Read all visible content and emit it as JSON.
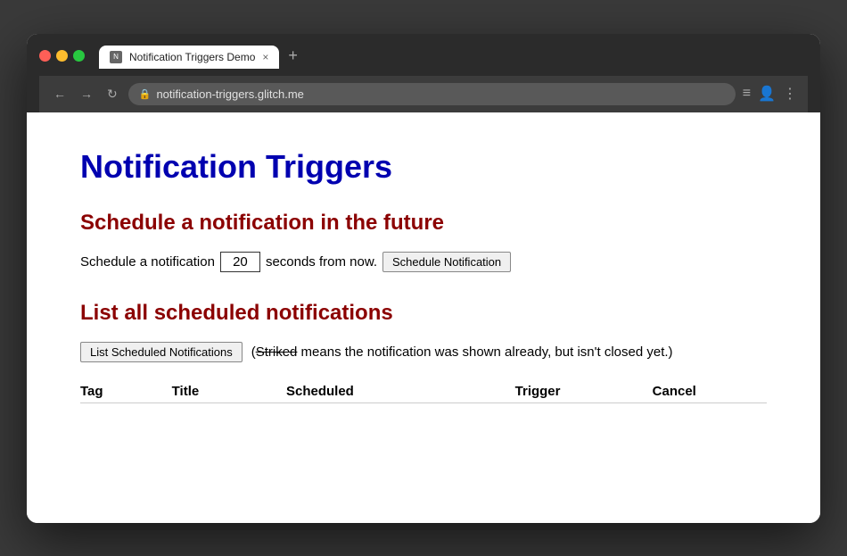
{
  "browser": {
    "tab": {
      "favicon_label": "N",
      "title": "Notification Triggers Demo",
      "close_label": "×",
      "new_tab_label": "+"
    },
    "nav": {
      "back_label": "←",
      "forward_label": "→",
      "reload_label": "↻"
    },
    "address_bar": {
      "lock_icon": "🔒",
      "url": "notification-triggers.glitch.me"
    },
    "toolbar_right": {
      "menu_icon": "≡",
      "account_icon": "👤",
      "more_icon": "⋮"
    }
  },
  "page": {
    "title": "Notification Triggers",
    "section1": {
      "heading": "Schedule a notification in the future",
      "label_before": "Schedule a notification",
      "seconds_value": "20",
      "label_after": "seconds from now.",
      "button_label": "Schedule Notification"
    },
    "section2": {
      "heading": "List all scheduled notifications",
      "button_label": "List Scheduled Notifications",
      "note_prefix": "(",
      "note_strikethrough": "Striked",
      "note_suffix": " means the notification was shown already, but isn't closed yet.)",
      "table": {
        "columns": [
          "Tag",
          "Title",
          "Scheduled",
          "Trigger",
          "Cancel"
        ],
        "rows": []
      }
    }
  }
}
